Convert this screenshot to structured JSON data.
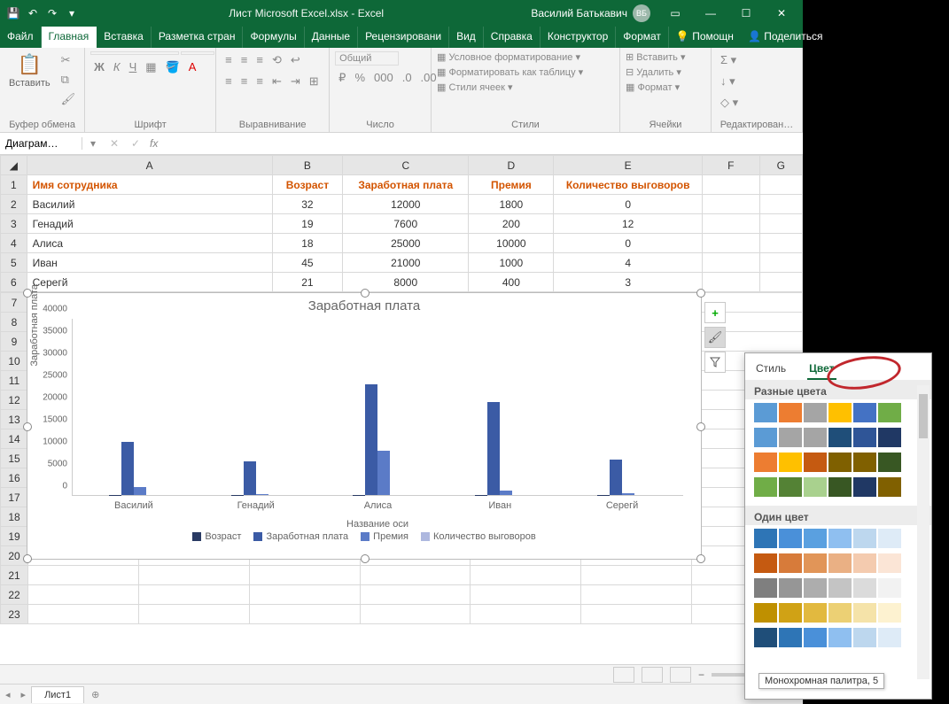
{
  "window": {
    "title": "Лист Microsoft Excel.xlsx - Excel",
    "user": "Василий Батькавич",
    "user_initials": "ВБ"
  },
  "tabs": {
    "file": "Файл",
    "home": "Главная",
    "insert": "Вставка",
    "layout": "Разметка стран",
    "formulas": "Формулы",
    "data": "Данные",
    "review": "Рецензировани",
    "view": "Вид",
    "help": "Справка",
    "design": "Конструктор",
    "format": "Формат",
    "assist": "Помощн",
    "share": "Поделиться"
  },
  "ribbon": {
    "paste": "Вставить",
    "clipboard": "Буфер обмена",
    "font_group": "Шрифт",
    "align_group": "Выравнивание",
    "number_group": "Число",
    "number_format": "Общий",
    "cond_fmt": "Условное форматирование",
    "as_table": "Форматировать как таблицу",
    "cell_styles": "Стили ячеек",
    "styles_group": "Стили",
    "insert_btn": "Вставить",
    "delete_btn": "Удалить",
    "format_btn": "Формат",
    "cells_group": "Ячейки",
    "editing_group": "Редактирован…",
    "bold": "Ж",
    "italic": "К",
    "underline": "Ч",
    "font_color": "А"
  },
  "namebox": "Диаграм…",
  "table": {
    "cols": [
      "A",
      "B",
      "C",
      "D",
      "E",
      "F",
      "G"
    ],
    "headers": {
      "a": "Имя сотрудника",
      "b": "Возраст",
      "c": "Заработная плата",
      "d": "Премия",
      "e": "Количество выговоров"
    },
    "rows": [
      {
        "name": "Василий",
        "age": 32,
        "salary": 12000,
        "bonus": 1800,
        "warnings": 0
      },
      {
        "name": "Генадий",
        "age": 19,
        "salary": 7600,
        "bonus": 200,
        "warnings": 12
      },
      {
        "name": "Алиса",
        "age": 18,
        "salary": 25000,
        "bonus": 10000,
        "warnings": 0
      },
      {
        "name": "Иван",
        "age": 45,
        "salary": 21000,
        "bonus": 1000,
        "warnings": 4
      },
      {
        "name": "Серегй",
        "age": 21,
        "salary": 8000,
        "bonus": 400,
        "warnings": 3
      }
    ]
  },
  "chart_data": {
    "type": "bar",
    "title": "Заработная плата",
    "xlabel": "Название оси",
    "ylabel": "Заработная плата",
    "ylim": [
      0,
      40000
    ],
    "yticks": [
      0,
      5000,
      10000,
      15000,
      20000,
      25000,
      30000,
      35000,
      40000
    ],
    "categories": [
      "Василий",
      "Генадий",
      "Алиса",
      "Иван",
      "Серегй"
    ],
    "series": [
      {
        "name": "Возраст",
        "color": "#293a63",
        "values": [
          32,
          19,
          18,
          45,
          21
        ]
      },
      {
        "name": "Заработная плата",
        "color": "#3b5ba5",
        "values": [
          12000,
          7600,
          25000,
          21000,
          8000
        ]
      },
      {
        "name": "Премия",
        "color": "#5b7bc7",
        "values": [
          1800,
          200,
          10000,
          1000,
          400
        ]
      },
      {
        "name": "Количество выговоров",
        "color": "#aeb8df",
        "values": [
          0,
          12,
          0,
          4,
          3
        ]
      }
    ]
  },
  "sheet_tab": "Лист1",
  "color_popup": {
    "tab_style": "Стиль",
    "tab_color": "Цвет",
    "section_colorful": "Разные цвета",
    "section_mono": "Один цвет",
    "tooltip": "Монохромная палитра, 5",
    "colorful_rows": [
      [
        "#5b9bd5",
        "#ed7d31",
        "#a5a5a5",
        "#ffc000",
        "#4472c4",
        "#70ad47"
      ],
      [
        "#5b9bd5",
        "#a5a5a5",
        "#a5a5a5",
        "#1f4e79",
        "#2f5597",
        "#203864"
      ],
      [
        "#ed7d31",
        "#ffc000",
        "#c55a11",
        "#7f6000",
        "#806000",
        "#385723"
      ],
      [
        "#70ad47",
        "#548235",
        "#a9d18e",
        "#385723",
        "#203864",
        "#806000"
      ]
    ],
    "mono_rows": [
      [
        "#2e75b6",
        "#4a90d9",
        "#5aa0e0",
        "#8fbff0",
        "#bdd7ee",
        "#deebf7"
      ],
      [
        "#c55a11",
        "#d77b3a",
        "#e19558",
        "#eab084",
        "#f4cbaf",
        "#fbe5d6"
      ],
      [
        "#7f7f7f",
        "#969696",
        "#adadad",
        "#c4c4c4",
        "#dbdbdb",
        "#f2f2f2"
      ],
      [
        "#bf9000",
        "#d0a215",
        "#e2b93f",
        "#ecd074",
        "#f5e3a9",
        "#fdf2d0"
      ],
      [
        "#1f4e79",
        "#2e75b6",
        "#4a90d9",
        "#8fbff0",
        "#bdd7ee",
        "#deebf7"
      ]
    ]
  }
}
